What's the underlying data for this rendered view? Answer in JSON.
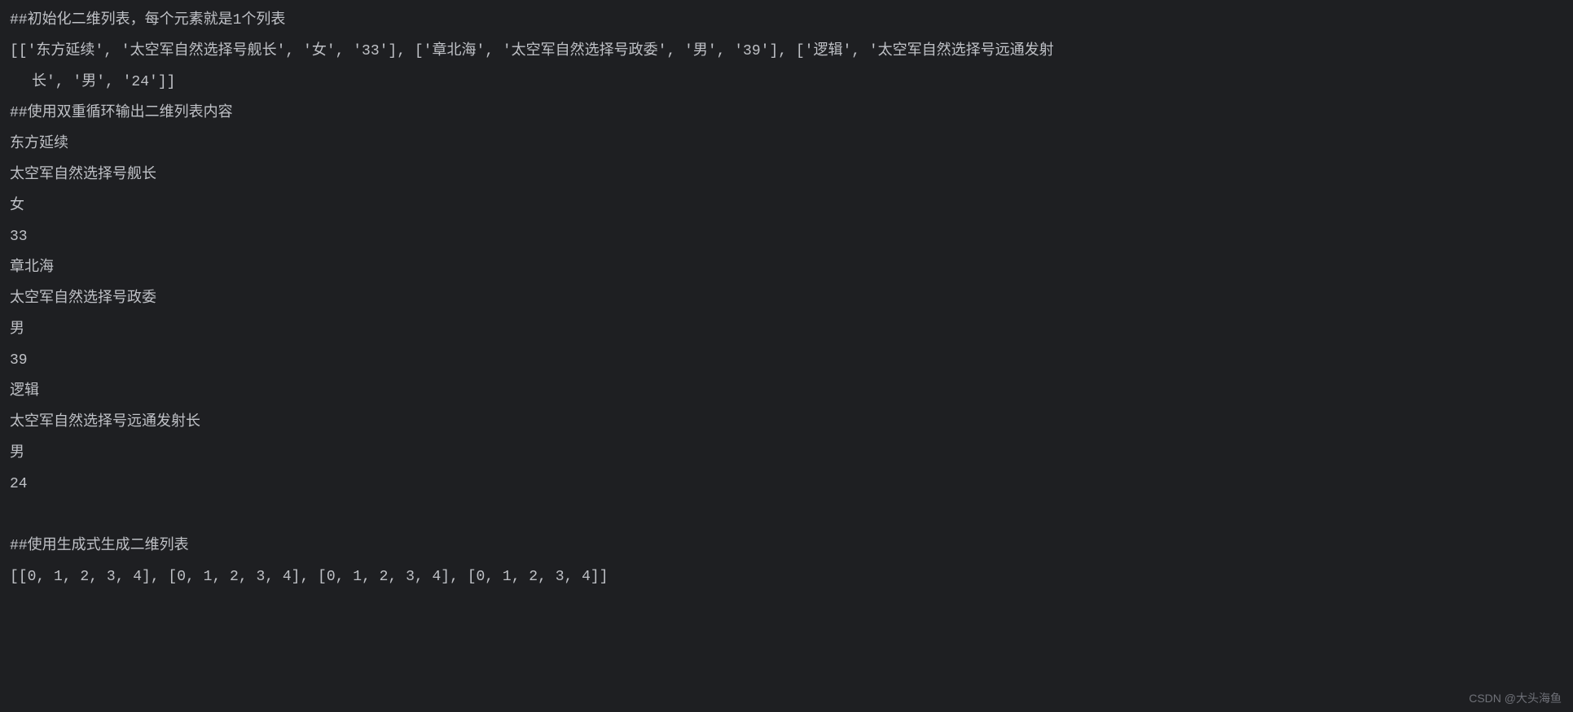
{
  "lines": [
    {
      "text": "##初始化二维列表，每个元素就是1个列表",
      "indent": false
    },
    {
      "text": "[['东方延续', '太空军自然选择号舰长', '女', '33'], ['章北海', '太空军自然选择号政委', '男', '39'], ['逻辑', '太空军自然选择号远通发射",
      "indent": false
    },
    {
      "text": "长', '男', '24']]",
      "indent": true
    },
    {
      "text": "##使用双重循环输出二维列表内容",
      "indent": false
    },
    {
      "text": "东方延续",
      "indent": false
    },
    {
      "text": "太空军自然选择号舰长",
      "indent": false
    },
    {
      "text": "女",
      "indent": false
    },
    {
      "text": "33",
      "indent": false
    },
    {
      "text": "章北海",
      "indent": false
    },
    {
      "text": "太空军自然选择号政委",
      "indent": false
    },
    {
      "text": "男",
      "indent": false
    },
    {
      "text": "39",
      "indent": false
    },
    {
      "text": "逻辑",
      "indent": false
    },
    {
      "text": "太空军自然选择号远通发射长",
      "indent": false
    },
    {
      "text": "男",
      "indent": false
    },
    {
      "text": "24",
      "indent": false
    },
    {
      "text": " ",
      "indent": false
    },
    {
      "text": "##使用生成式生成二维列表",
      "indent": false
    },
    {
      "text": "[[0, 1, 2, 3, 4], [0, 1, 2, 3, 4], [0, 1, 2, 3, 4], [0, 1, 2, 3, 4]]",
      "indent": false
    }
  ],
  "watermark": "CSDN @大头海鱼"
}
